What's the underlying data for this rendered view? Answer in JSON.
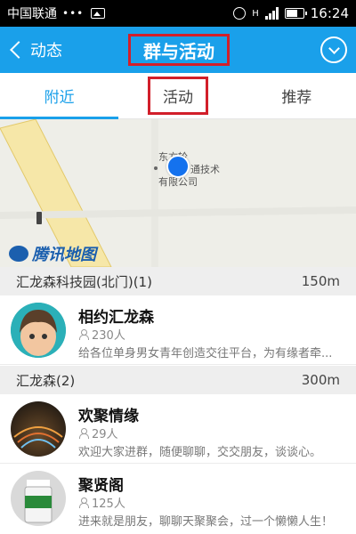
{
  "status_bar": {
    "carrier": "中国联通",
    "dots": "•••",
    "signal": "H",
    "time": "16:24"
  },
  "header": {
    "back_label": "动态",
    "title": "群与活动"
  },
  "tabs": [
    {
      "label": "附近",
      "active": true
    },
    {
      "label": "活动",
      "active": false
    },
    {
      "label": "推荐",
      "active": false
    }
  ],
  "map": {
    "poi_label_line1": "东方轮",
    "poi_label_line2": "通技术",
    "poi_label_line3": "有限公司",
    "logo_text": "腾讯地图"
  },
  "sections": [
    {
      "title": "汇龙森科技园(北门)(1)",
      "distance": "150m",
      "items": [
        {
          "name": "相约汇龙森",
          "members": "230人",
          "desc": "给各位单身男女青年创造交往平台，为有缘者牵..."
        }
      ]
    },
    {
      "title": "汇龙森(2)",
      "distance": "300m",
      "items": [
        {
          "name": "欢聚情缘",
          "members": "29人",
          "desc": "欢迎大家进群，随便聊聊，交交朋友，谈谈心。"
        },
        {
          "name": "聚贤阁",
          "members": "125人",
          "desc": "进来就是朋友，聊聊天聚聚会，过一个懒懒人生！"
        }
      ]
    }
  ],
  "colors": {
    "accent": "#1aa0ea",
    "highlight_box": "#d21f2a",
    "location_dot": "#1472ee"
  }
}
